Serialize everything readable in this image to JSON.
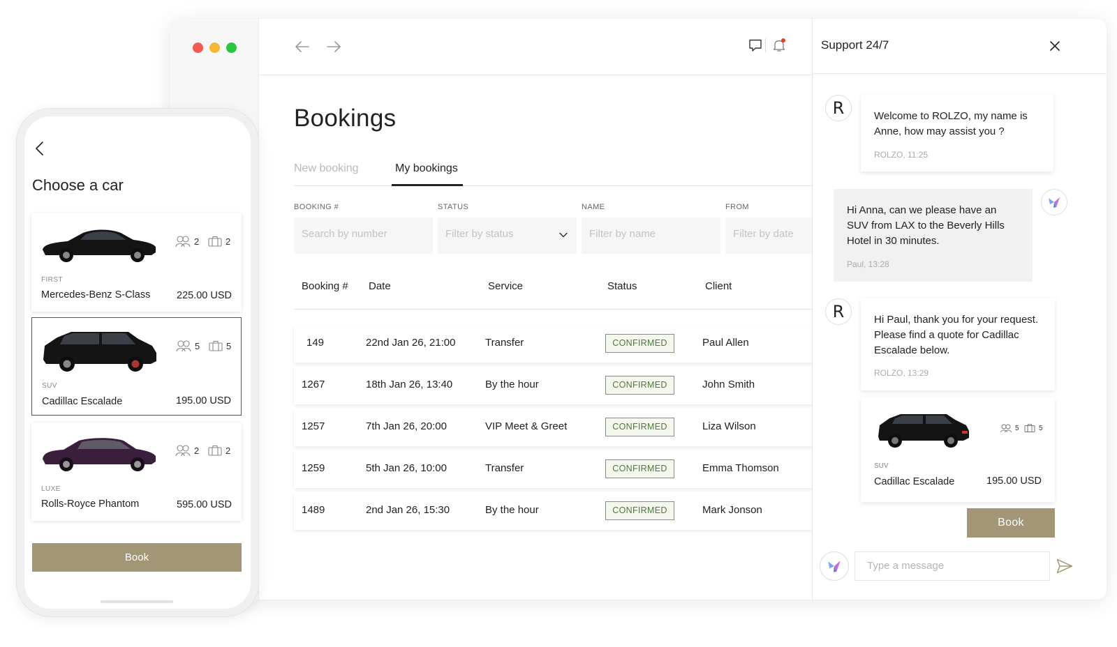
{
  "window": {
    "nav": {
      "back_icon": "arrow-left-icon",
      "forward_icon": "arrow-right-icon"
    },
    "top_icons": [
      "chat-bubble-icon",
      "bell-icon"
    ],
    "notification_dot_color": "#e53935"
  },
  "bookings": {
    "title": "Bookings",
    "tabs": [
      {
        "label": "New booking",
        "active": false
      },
      {
        "label": "My bookings",
        "active": true
      }
    ],
    "filters": [
      {
        "label": "BOOKING #",
        "placeholder": "Search by number"
      },
      {
        "label": "STATUS",
        "placeholder": "Filter by status"
      },
      {
        "label": "NAME",
        "placeholder": "Filter by name"
      },
      {
        "label": "FROM",
        "placeholder": "Filter by date"
      }
    ],
    "columns": [
      "Booking #",
      "Date",
      "Service",
      "Status",
      "Client"
    ],
    "rows": [
      {
        "number": "149",
        "date": "22nd Jan 26, 21:00",
        "service": "Transfer",
        "status": "CONFIRMED",
        "client": "Paul Allen"
      },
      {
        "number": "1267",
        "date": "18th Jan 26, 13:40",
        "service": "By the hour",
        "status": "CONFIRMED",
        "client": "John Smith"
      },
      {
        "number": "1257",
        "date": "7th Jan 26, 20:00",
        "service": "VIP Meet & Greet",
        "status": "CONFIRMED",
        "client": "Liza Wilson"
      },
      {
        "number": "1259",
        "date": "5th Jan 26, 10:00",
        "service": "Transfer",
        "status": "CONFIRMED",
        "client": "Emma Thomson"
      },
      {
        "number": "1489",
        "date": "2nd Jan 26, 15:30",
        "service": "By the hour",
        "status": "CONFIRMED",
        "client": "Mark Jonson"
      }
    ],
    "status_color": "#55773a"
  },
  "chat": {
    "title": "Support 24/7",
    "agent_initial": "R",
    "messages": [
      {
        "from": "agent",
        "text": "Welcome to ROLZO, my name is Anne, how may assist you ?",
        "meta": "ROLZO, 11:25"
      },
      {
        "from": "user",
        "text": "Hi Anna, can we please have an SUV from LAX to the Beverly Hills Hotel in 30 minutes.",
        "meta": "Paul, 13:28"
      },
      {
        "from": "agent",
        "text": "Hi Paul, thank you for your request. Please find a quote for Cadillac Escalade below.",
        "meta": "ROLZO, 13:29"
      }
    ],
    "quote": {
      "class": "SUV",
      "name": "Cadillac Escalade",
      "price": "195.00 USD",
      "passengers": "5",
      "luggage": "5"
    },
    "book_label": "Book",
    "input_placeholder": "Type a message",
    "accent_color": "#a39676"
  },
  "phone": {
    "title": "Choose a car",
    "cars": [
      {
        "class": "FIRST",
        "name": "Mercedes-Benz S-Class",
        "price": "225.00 USD",
        "passengers": "2",
        "luggage": "2",
        "color": "#111111",
        "selected": false
      },
      {
        "class": "SUV",
        "name": "Cadillac Escalade",
        "price": "195.00 USD",
        "passengers": "5",
        "luggage": "5",
        "color": "#111111",
        "selected": true
      },
      {
        "class": "LUXE",
        "name": "Rolls-Royce Phantom",
        "price": "595.00 USD",
        "passengers": "2",
        "luggage": "2",
        "color": "#3a1f3d",
        "selected": false
      }
    ],
    "book_label": "Book"
  }
}
